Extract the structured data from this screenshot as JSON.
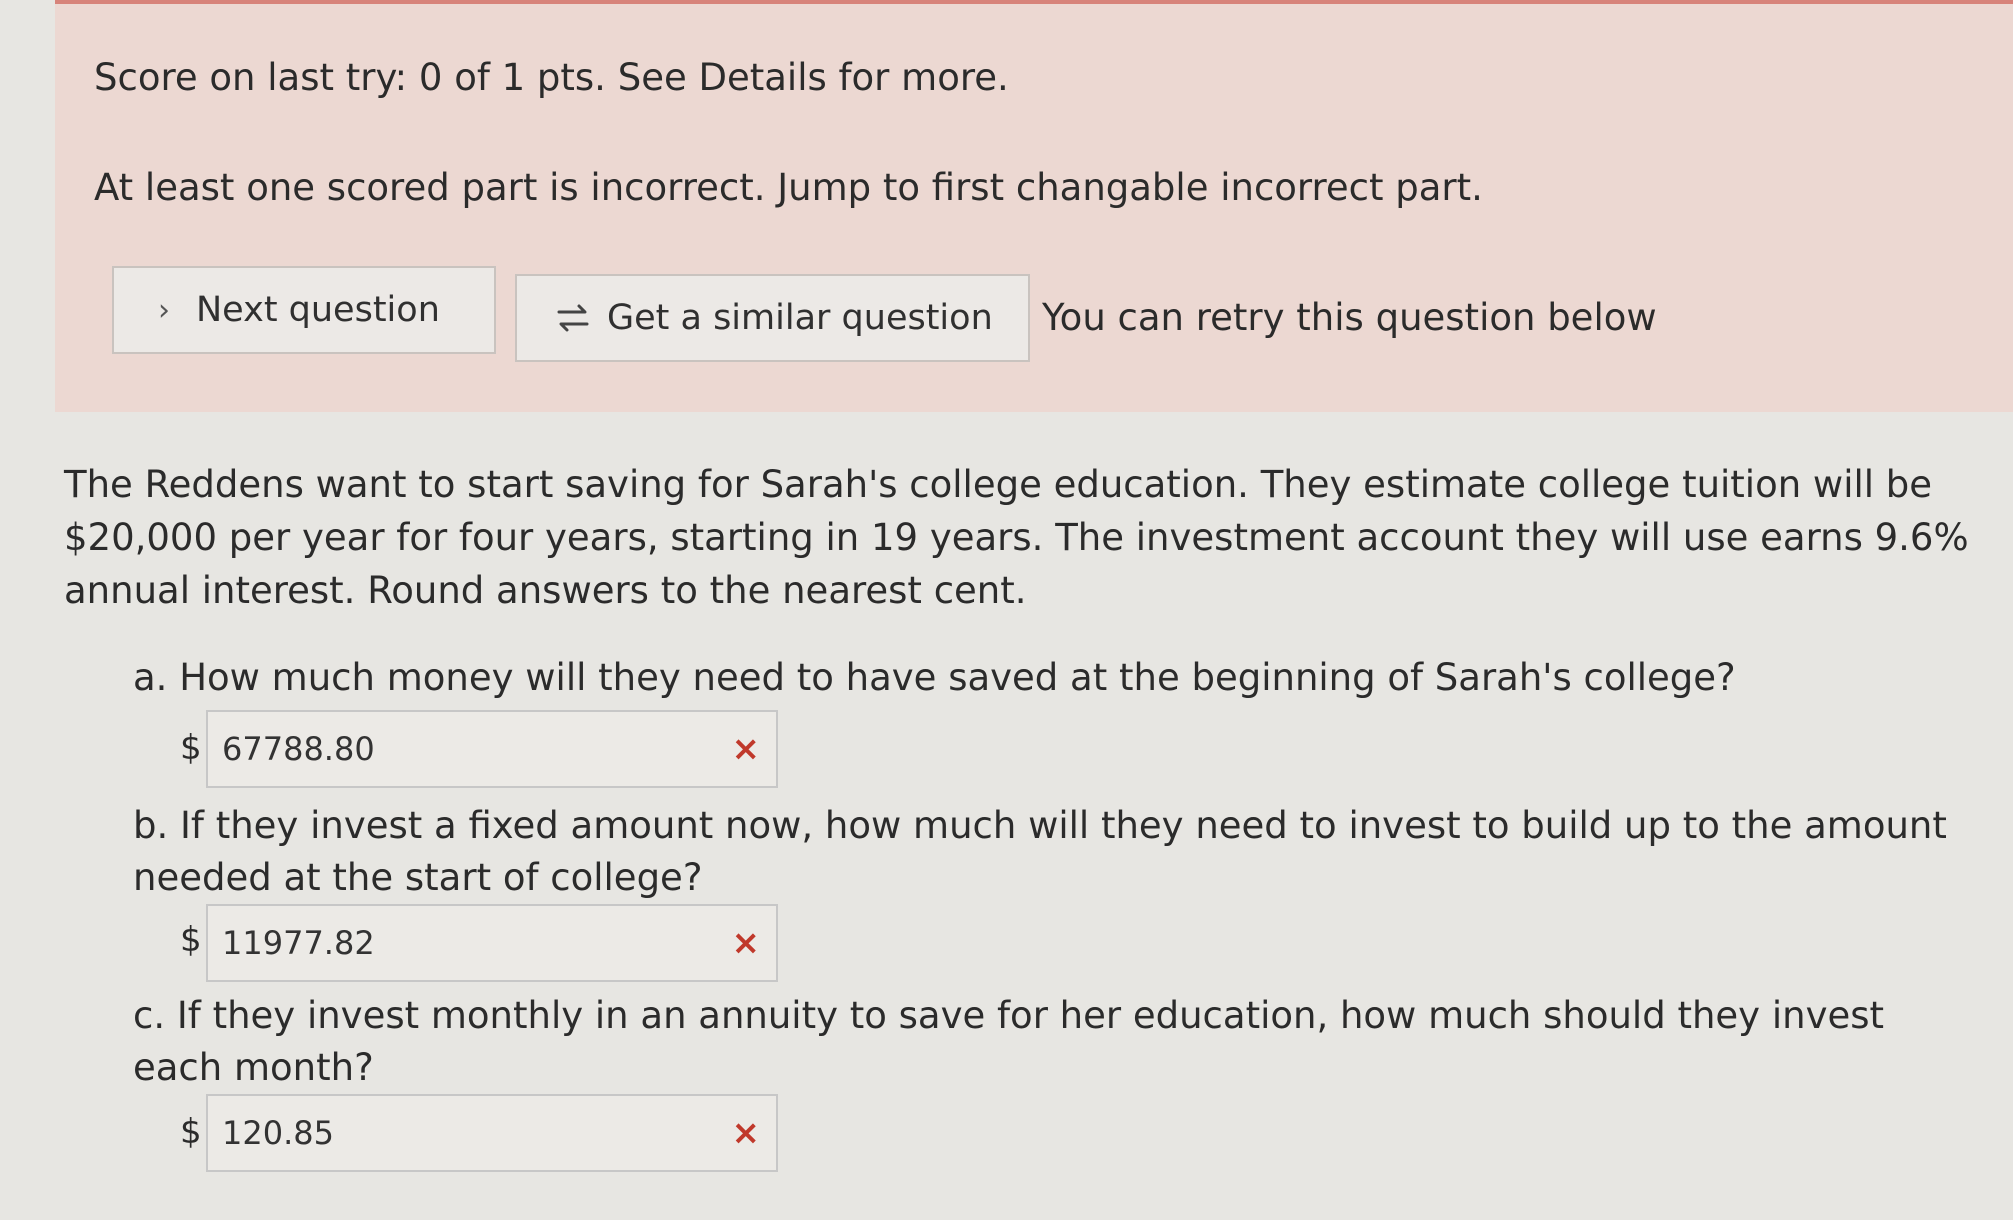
{
  "feedback": {
    "score_text": "Score on last try: 0 of 1 pts. See Details for more.",
    "incorrect_text": "At least one scored part is incorrect. Jump to first changable incorrect part.",
    "next_button_label": "Next question",
    "similar_button_label": "Get a similar question",
    "retry_text": "You can retry this question below"
  },
  "question": {
    "text": "The Reddens want to start saving for Sarah's college education. They estimate college tuition will be $20,000 per year for four years, starting in 19 years. The investment account they will use earns 9.6% annual interest. Round answers to the nearest cent.",
    "parts": [
      {
        "prompt": "a. How much money will they need to have saved at the beginning of Sarah's college?",
        "currency": "$",
        "value": "67788.80",
        "status": "incorrect"
      },
      {
        "prompt": "b. If they invest a fixed amount now, how much will they need to invest to build up to the amount needed at the start of college?",
        "currency": "$",
        "value": "11977.82",
        "status": "incorrect"
      },
      {
        "prompt": "c. If they invest monthly in an annuity to save for her education, how much should they invest each month?",
        "currency": "$",
        "value": "120.85",
        "status": "incorrect"
      }
    ]
  },
  "icons": {
    "incorrect_mark": "×",
    "next_chevron": "›"
  },
  "colors": {
    "banner_bg": "#ecd8d2",
    "incorrect_red": "#c0392b"
  }
}
